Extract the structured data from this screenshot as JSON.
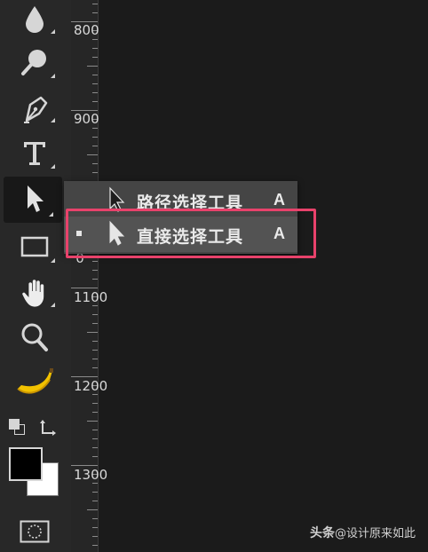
{
  "toolbar": {
    "tools": [
      {
        "name": "blur-tool-button",
        "icon": "drop-icon"
      },
      {
        "name": "dodge-tool-button",
        "icon": "dodge-icon"
      },
      {
        "name": "pen-tool-button",
        "icon": "pen-icon"
      },
      {
        "name": "type-tool-button",
        "icon": "type-icon"
      },
      {
        "name": "path-selection-tool-button",
        "icon": "arrow-cursor-icon",
        "active": true
      },
      {
        "name": "rectangle-tool-button",
        "icon": "rectangle-icon"
      },
      {
        "name": "hand-tool-button",
        "icon": "hand-icon"
      },
      {
        "name": "zoom-tool-button",
        "icon": "magnifier-icon"
      },
      {
        "name": "banana-tool-button",
        "icon": "banana-icon"
      }
    ],
    "foreground_color": "#000000",
    "background_color": "#ffffff"
  },
  "ruler": {
    "labels": [
      "800",
      "900",
      "0",
      "1100",
      "1200",
      "1300"
    ]
  },
  "flyout": {
    "items": [
      {
        "label": "路径选择工具",
        "shortcut": "A",
        "selected": false
      },
      {
        "label": "直接选择工具",
        "shortcut": "A",
        "selected": true
      }
    ]
  },
  "highlight_color": "#e8426b",
  "watermark": {
    "brand": "头条",
    "handle": "@设计原来如此"
  }
}
